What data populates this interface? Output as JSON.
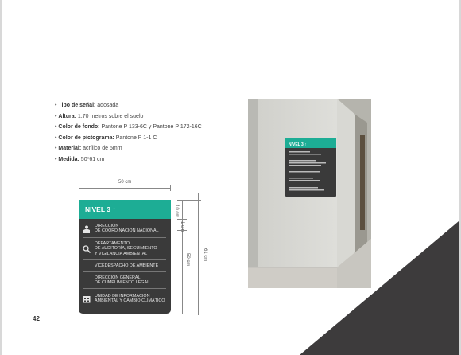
{
  "page_number": "42",
  "specs": [
    {
      "label": "Tipo de señal:",
      "value": " adosada"
    },
    {
      "label": "Altura:",
      "value": " 1.70 metros sobre el suelo"
    },
    {
      "label": "Color de fondo:",
      "value": " Pantone P 133-6C y Pantone P 172-16C"
    },
    {
      "label": "Color de pictograma:",
      "value": " Pantone P 1-1 C"
    },
    {
      "label": "Material:",
      "value": " acrílico de 5mm"
    },
    {
      "label": "Medida:",
      "value": " 50*61 cm"
    }
  ],
  "dimensions": {
    "width": "50 cm",
    "header": "10 cm",
    "gap": "1 cm",
    "body": "50 cm",
    "total": "61 cm"
  },
  "sign": {
    "title": "NIVEL 3 ↑",
    "items": [
      {
        "icon": "person-icon",
        "text": [
          "DIRECCIÓN",
          "DE COORDINACIÓN NACIONAL"
        ]
      },
      {
        "icon": "magnifier-icon",
        "text": [
          "DEPARTAMENTO",
          "DE AUDITORÍA, SEGUIMIENTO",
          "Y VIGILANCIA AMBIENTAL"
        ]
      },
      {
        "icon": "",
        "text": [
          "VICEDESPACHO DE AMBIENTE"
        ]
      },
      {
        "icon": "",
        "text": [
          "DIRECCIÓN GENERAL",
          "DE CUMPLIMIENTO LEGAL"
        ]
      },
      {
        "icon": "info-building-icon",
        "text": [
          "UNIDAD DE INFORMACIÓN",
          "AMBIENTAL Y CAMBIO CLIMÁTICO"
        ]
      }
    ]
  },
  "colors": {
    "teal": "#1dad95",
    "dark": "#3a3a3a",
    "corner": "#3d3b3c"
  }
}
